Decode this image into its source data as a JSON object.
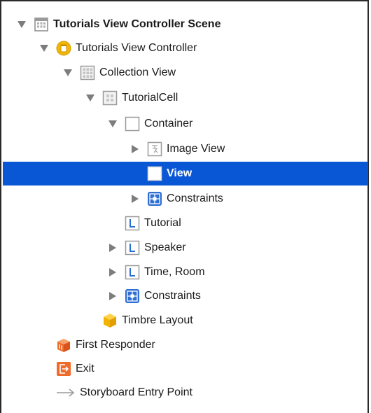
{
  "outline": {
    "items": [
      {
        "label": "Tutorials View Controller Scene",
        "icon": "scene-icon"
      },
      {
        "label": "Tutorials View Controller",
        "icon": "view-controller-icon"
      },
      {
        "label": "Collection View",
        "icon": "collection-view-icon"
      },
      {
        "label": "TutorialCell",
        "icon": "collection-cell-icon"
      },
      {
        "label": "Container",
        "icon": "view-icon"
      },
      {
        "label": "Image View",
        "icon": "image-view-icon"
      },
      {
        "label": "View",
        "icon": "view-icon"
      },
      {
        "label": "Constraints",
        "icon": "constraints-icon"
      },
      {
        "label": "Tutorial",
        "icon": "label-icon"
      },
      {
        "label": "Speaker",
        "icon": "label-icon"
      },
      {
        "label": "Time, Room",
        "icon": "label-icon"
      },
      {
        "label": "Constraints",
        "icon": "constraints-icon"
      },
      {
        "label": "Timbre Layout",
        "icon": "cube-icon"
      },
      {
        "label": "First Responder",
        "icon": "first-responder-icon"
      },
      {
        "label": "Exit",
        "icon": "exit-icon"
      },
      {
        "label": "Storyboard Entry Point",
        "icon": "arrow-icon"
      }
    ],
    "selected_label": "View"
  },
  "colors": {
    "selection": "#0a57d6",
    "constraints_blue": "#2f6fd4",
    "view_controller_yellow": "#f2b707",
    "exit_orange": "#f06a2a",
    "label_blue": "#2a6fd0"
  }
}
